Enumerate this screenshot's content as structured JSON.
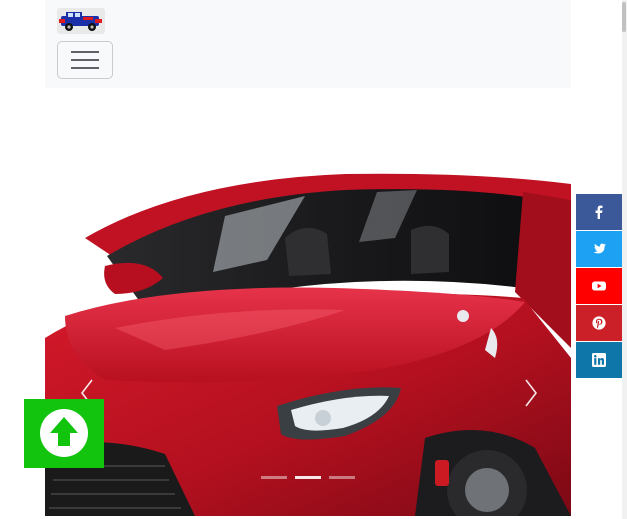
{
  "navbar": {
    "logo_icon": "jeep-logo",
    "toggler_icon": "hamburger-menu-icon"
  },
  "carousel": {
    "image": "red-sedan-front-view",
    "prev_icon": "chevron-left-icon",
    "next_icon": "chevron-right-icon",
    "slide_count": 3,
    "active_slide": 2
  },
  "scroll_top": {
    "icon": "arrow-up-circle-icon",
    "color": "#13c40f"
  },
  "social": [
    {
      "name": "facebook",
      "icon": "facebook-icon",
      "color": "#3b5998"
    },
    {
      "name": "twitter",
      "icon": "twitter-icon",
      "color": "#1da1f2"
    },
    {
      "name": "youtube",
      "icon": "youtube-icon",
      "color": "#ff0000"
    },
    {
      "name": "pinterest",
      "icon": "pinterest-icon",
      "color": "#cb2027"
    },
    {
      "name": "linkedin",
      "icon": "linkedin-icon",
      "color": "#0e76a8"
    }
  ]
}
